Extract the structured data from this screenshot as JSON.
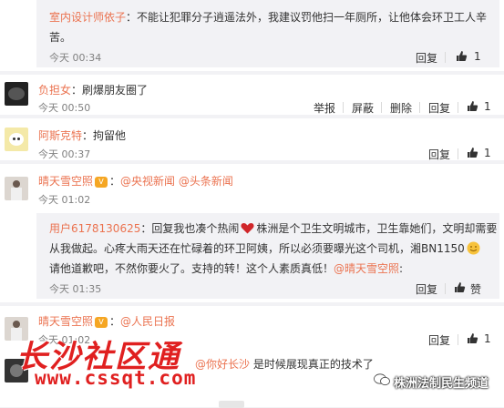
{
  "comments": [
    {
      "name": "室内设计师依子",
      "text_line1": "：不能让犯罪分子逍遥法外，我建议罚他扫一年厕所，让他体会环卫工人辛",
      "text_line2": "苦。",
      "time": "今天 00:34",
      "reply": "回复",
      "likes": "1"
    },
    {
      "name": "负担女",
      "text": "：刷爆朋友圈了",
      "time": "今天 00:50",
      "report": "举报",
      "block": "屏蔽",
      "delete": "删除",
      "reply": "回复",
      "likes": "1"
    },
    {
      "name": "阿斯克特",
      "text": "：拘留他",
      "time": "今天 00:37",
      "reply": "回复",
      "likes": "1"
    },
    {
      "name": "晴天雪空照",
      "mention1": "@央视新闻",
      "mention2": "@头条新闻",
      "time": "今天 01:02",
      "reply": "回复",
      "likes": "1",
      "nested": {
        "user": "用户6178130625",
        "line1": "：回复我也凑个热闹",
        "line1b": "株洲是个卫生文明城市，卫生靠她们，文明却需要",
        "line2": "从我做起。心疼大雨天还在忙碌着的环卫阿姨，所以必须要曝光这个司机，湘BN1150",
        "line3a": "请他道歉吧，不然你要火了。支持的转！这个人素质真低！",
        "line3_mention": "@晴天雪空照",
        "line3b": ":",
        "time": "今天 01:35",
        "reply": "回复",
        "like_label": "赞"
      }
    },
    {
      "name": "晴天雪空照",
      "mention": "@人民日报",
      "time": "今天 01:02",
      "reply": "回复",
      "likes": "1"
    },
    {
      "mention": "@你好长沙",
      "text": "是时候展现真正的技术了"
    }
  ],
  "watermark": {
    "brand": "长沙社区通",
    "url": "www.cssqt.com",
    "right": "株洲法制民生频道"
  },
  "icons": [
    "thumb-up-icon",
    "love-heart-emoji",
    "smile-emoji",
    "v-badge-icon"
  ]
}
